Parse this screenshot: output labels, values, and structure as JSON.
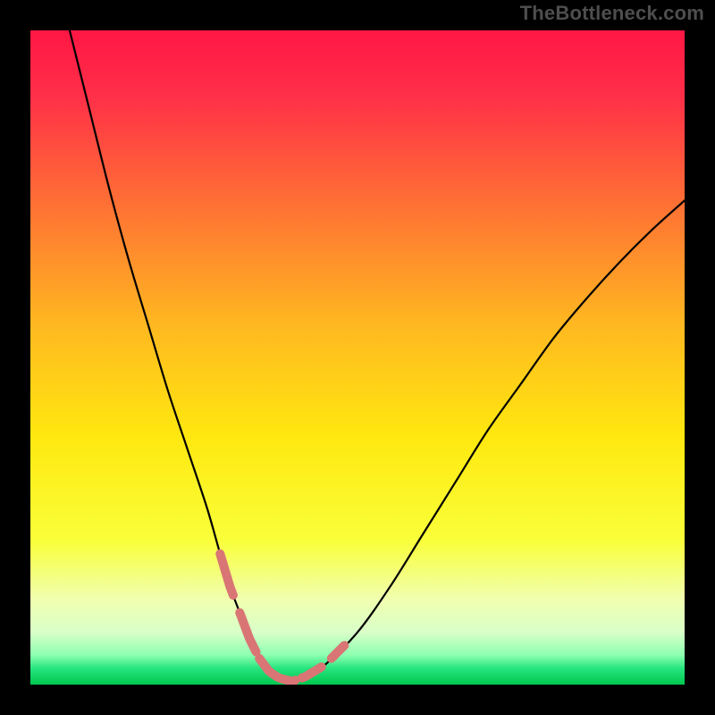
{
  "watermark": "TheBottleneck.com",
  "colors": {
    "frame": "#000000",
    "watermark": "#4e4e4e",
    "curve": "#000000",
    "dash": "#d97575",
    "gradient_stops": [
      {
        "offset": 0.0,
        "color": "#ff1744"
      },
      {
        "offset": 0.1,
        "color": "#ff2f48"
      },
      {
        "offset": 0.25,
        "color": "#ff6a36"
      },
      {
        "offset": 0.45,
        "color": "#ffb820"
      },
      {
        "offset": 0.62,
        "color": "#ffe80f"
      },
      {
        "offset": 0.78,
        "color": "#f9ff3a"
      },
      {
        "offset": 0.87,
        "color": "#f0ffb0"
      },
      {
        "offset": 0.92,
        "color": "#d9ffc8"
      },
      {
        "offset": 0.955,
        "color": "#8cffb0"
      },
      {
        "offset": 0.975,
        "color": "#27e57e"
      },
      {
        "offset": 1.0,
        "color": "#00c74e"
      }
    ]
  },
  "chart_data": {
    "type": "line",
    "title": "",
    "xlabel": "",
    "ylabel": "",
    "xlim": [
      0,
      100
    ],
    "ylim": [
      0,
      100
    ],
    "grid": false,
    "series": [
      {
        "name": "bottleneck-curve",
        "x": [
          6,
          9,
          12,
          15,
          18,
          21,
          24,
          27,
          29,
          30.5,
          32,
          33.5,
          35,
          36.5,
          38,
          40,
          42,
          45,
          50,
          55,
          60,
          65,
          70,
          75,
          80,
          85,
          90,
          95,
          100
        ],
        "y": [
          100,
          88,
          76,
          65,
          55,
          45,
          36,
          27,
          20,
          15,
          11,
          7,
          4,
          2,
          1,
          0.5,
          1.2,
          3,
          8,
          15,
          23,
          31,
          39,
          46,
          53,
          59,
          64.5,
          69.5,
          74
        ]
      }
    ],
    "dash_segments": {
      "name": "highlight-low-region",
      "x_ranges": [
        [
          29,
          31
        ],
        [
          32,
          34.5
        ],
        [
          35,
          40.5
        ],
        [
          41.5,
          44.5
        ],
        [
          46,
          48
        ]
      ],
      "note": "pink dashed overlay near curve minimum"
    }
  }
}
